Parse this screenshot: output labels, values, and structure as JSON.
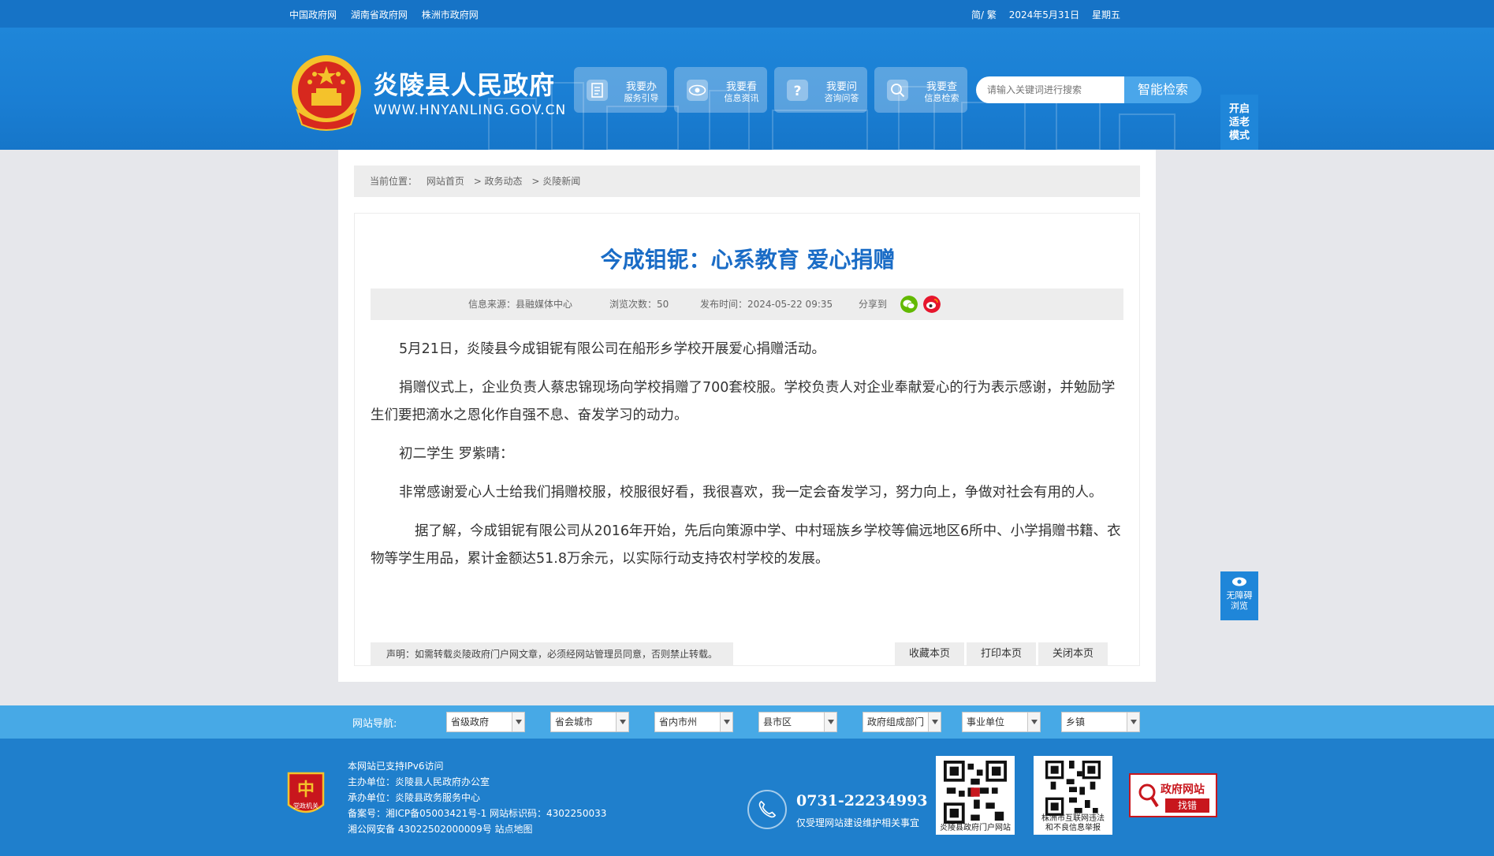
{
  "topbar": {
    "links": [
      "中国政府网",
      "湖南省政府网",
      "株洲市政府网"
    ],
    "lang": "简/ 繁",
    "date": "2024年5月31日",
    "weekday": "星期五"
  },
  "header": {
    "site_title": "炎陵县人民政府",
    "site_url": "WWW.HNYANLING.GOV.CN",
    "nav_buttons": [
      {
        "title": "我要办",
        "sub": "服务引导",
        "icon": "document-icon"
      },
      {
        "title": "我要看",
        "sub": "信息资讯",
        "icon": "eye-icon"
      },
      {
        "title": "我要问",
        "sub": "咨询问答",
        "icon": "question-icon"
      },
      {
        "title": "我要查",
        "sub": "信息检索",
        "icon": "search-icon"
      }
    ],
    "search_placeholder": "请输入关键词进行搜索",
    "search_button": "智能检索"
  },
  "side": {
    "elder_mode": "开启\n适老\n模式",
    "elder_lines": [
      "开启",
      "适老",
      "模式"
    ],
    "accessibility_lines": [
      "无障碍",
      "浏览"
    ]
  },
  "breadcrumb": {
    "label": "当前位置：",
    "items": [
      "网站首页",
      "> 政务动态",
      "> 炎陵新闻"
    ]
  },
  "article": {
    "title": "今成钼铌：心系教育 爱心捐赠",
    "source": "信息来源：县融媒体中心",
    "views": "浏览次数：50",
    "published": "发布时间：2024-05-22 09:35",
    "share_label": "分享到",
    "paragraphs": [
      "5月21日，炎陵县今成钼铌有限公司在船形乡学校开展爱心捐赠活动。",
      "捐赠仪式上，企业负责人蔡忠锦现场向学校捐赠了700套校服。学校负责人对企业奉献爱心的行为表示感谢，并勉励学生们要把滴水之恩化作自强不息、奋发学习的动力。",
      "初二学生 罗紫晴：",
      "非常感谢爱心人士给我们捐赠校服，校服很好看，我很喜欢，我一定会奋发学习，努力向上，争做对社会有用的人。",
      "据了解，今成钼铌有限公司从2016年开始，先后向策源中学、中村瑶族乡学校等偏远地区6所中、小学捐赠书籍、衣物等学生用品，累计金额达51.8万余元，以实际行动支持农村学校的发展。"
    ],
    "notice": "声明：如需转载炎陵政府门户网文章，必须经网站管理员同意，否则禁止转载。",
    "actions": [
      "收藏本页",
      "打印本页",
      "关闭本页"
    ]
  },
  "sitenav": {
    "label": "网站导航:",
    "selects": [
      "省级政府",
      "省会城市",
      "省内市州",
      "县市区",
      "政府组成部门",
      "事业单位",
      "乡镇"
    ]
  },
  "footer": {
    "lines": [
      "本网站已支持IPv6访问",
      "主办单位：炎陵县人民政府办公室",
      "承办单位：炎陵县政务服务中心",
      "备案号：湘ICP备05003421号-1 网站标识码：4302250033",
      "湘公网安备 43022502000009号 站点地图"
    ],
    "badge_text": "党政机关",
    "phone": "0731-22234993",
    "phone_note": "仅受理网站建设维护相关事宜",
    "qr1_caption": "炎陵县政府门户网站",
    "qr2_caption_lines": [
      "株洲市互联网违法",
      "和不良信息举报"
    ],
    "gov_error_title": "政府网站",
    "gov_error_sub": "找错"
  },
  "colors": {
    "brand_blue": "#1673c6",
    "title_blue": "#1a6cc6",
    "nav_blue": "#47a9e6",
    "footer_blue": "#1f7fcc",
    "error_red": "#c8161d"
  }
}
